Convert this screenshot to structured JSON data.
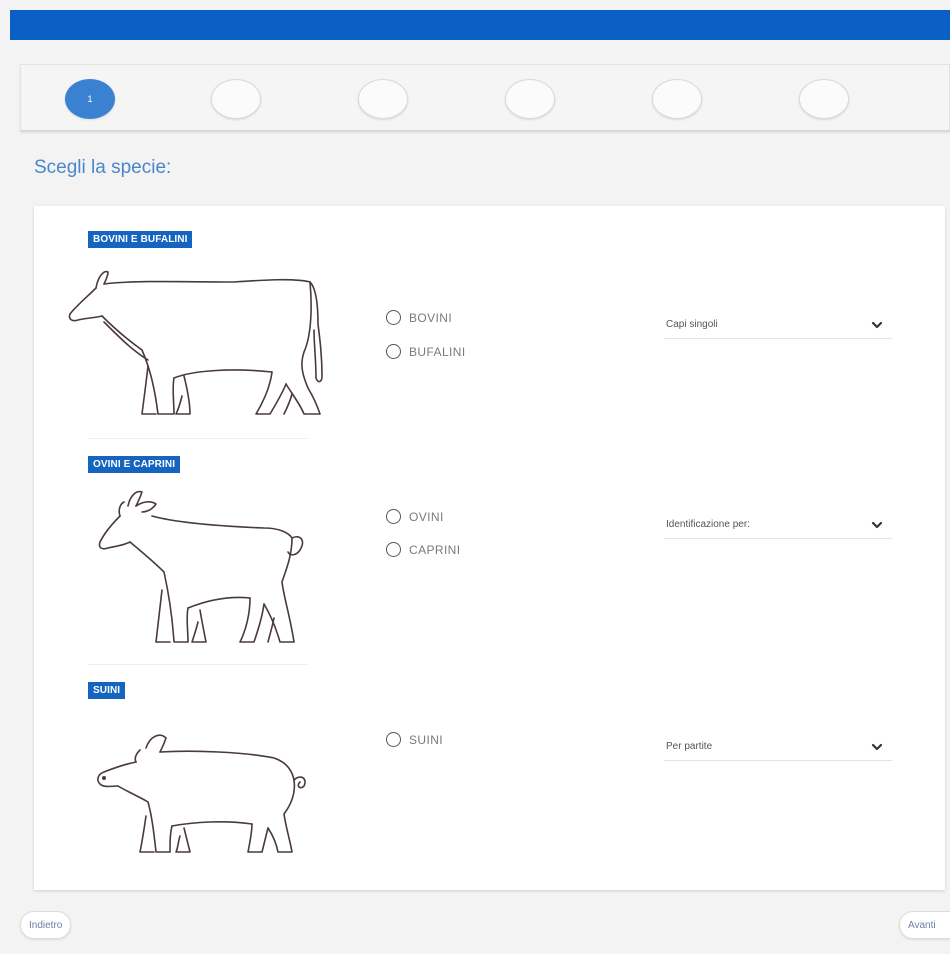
{
  "header": {
    "accent_color": "#0b60c6"
  },
  "stepper": {
    "steps": [
      {
        "label": "1",
        "active": true
      },
      {
        "label": "",
        "active": false
      },
      {
        "label": "",
        "active": false
      },
      {
        "label": "",
        "active": false
      },
      {
        "label": "",
        "active": false
      },
      {
        "label": "",
        "active": false
      }
    ]
  },
  "page_title": "Scegli la specie:",
  "sections": [
    {
      "tag": "BOVINI E BUFALINI",
      "animal_icon": "cow-outline",
      "options": [
        "BOVINI",
        "BUFALINI"
      ],
      "select_value": "Capi singoli"
    },
    {
      "tag": "OVINI E CAPRINI",
      "animal_icon": "goat-outline",
      "options": [
        "OVINI",
        "CAPRINI"
      ],
      "select_value": "Identificazione per:"
    },
    {
      "tag": "SUINI",
      "animal_icon": "pig-outline",
      "options": [
        "SUINI"
      ],
      "select_value": "Per partite"
    }
  ],
  "footer": {
    "back_label": "Indietro",
    "next_label": "Avanti"
  }
}
